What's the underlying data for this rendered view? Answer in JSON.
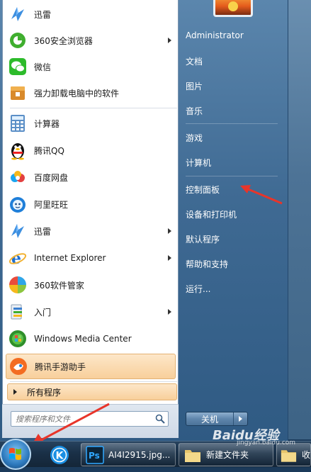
{
  "start_menu": {
    "left_items": [
      {
        "label": "迅雷",
        "icon": "xunlei-icon",
        "submenu": false
      },
      {
        "label": "360安全浏览器",
        "icon": "360-browser-icon",
        "submenu": true
      },
      {
        "label": "微信",
        "icon": "wechat-icon",
        "submenu": false
      },
      {
        "label": "强力卸载电脑中的软件",
        "icon": "uninstall-icon",
        "submenu": false
      },
      {
        "label": "计算器",
        "icon": "calculator-icon",
        "submenu": false
      },
      {
        "label": "腾讯QQ",
        "icon": "qq-penguin-icon",
        "submenu": false
      },
      {
        "label": "百度网盘",
        "icon": "baidu-netdisk-icon",
        "submenu": false
      },
      {
        "label": "阿里旺旺",
        "icon": "aliwangwang-icon",
        "submenu": false
      },
      {
        "label": "迅雷",
        "icon": "xunlei-icon",
        "submenu": true
      },
      {
        "label": "Internet Explorer",
        "icon": "internet-explorer-icon",
        "submenu": true
      },
      {
        "label": "360软件管家",
        "icon": "360-software-icon",
        "submenu": false
      },
      {
        "label": "入门",
        "icon": "getting-started-icon",
        "submenu": true
      },
      {
        "label": "Windows Media Center",
        "icon": "media-center-icon",
        "submenu": false
      },
      {
        "label": "腾讯手游助手",
        "icon": "tencent-game-assistant-icon",
        "submenu": false
      }
    ],
    "all_programs": "所有程序",
    "search_placeholder": "搜索程序和文件",
    "right_items": {
      "user": "Administrator",
      "documents": "文档",
      "pictures": "图片",
      "music": "音乐",
      "games": "游戏",
      "computer": "计算机",
      "control_panel": "控制面板",
      "devices_printers": "设备和打印机",
      "default_programs": "默认程序",
      "help_support": "帮助和支持",
      "run": "运行..."
    },
    "shutdown_label": "关机"
  },
  "taskbar": {
    "photoshop_window": "AI4I2915.jpg...",
    "folder_window": "新建文件夹",
    "partial_window": "收"
  },
  "watermark": {
    "brand": "Baidu经验",
    "url": "jingyan.baidu.com"
  },
  "colors": {
    "highlight": "#f8cf9b",
    "annotation_arrow": "#e8352a"
  }
}
